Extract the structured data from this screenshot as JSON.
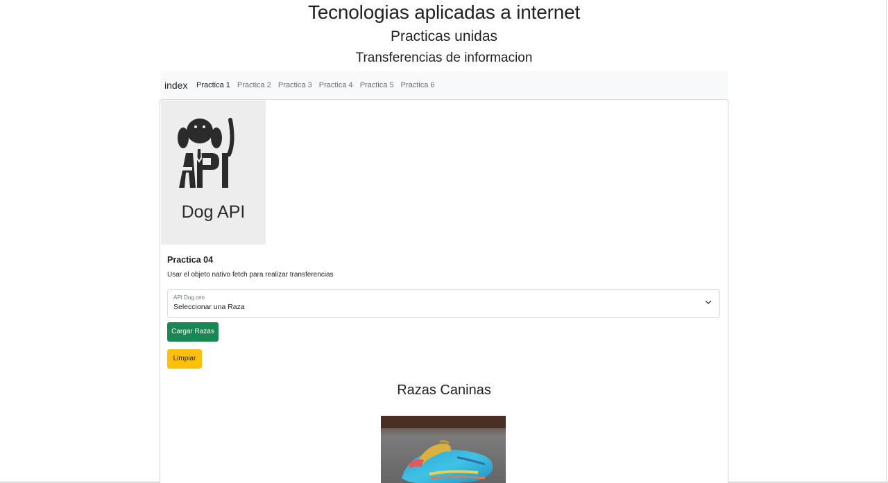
{
  "header": {
    "title": "Tecnologias aplicadas a internet",
    "subtitle": "Practicas unidas",
    "subsubtitle": "Transferencias de informacion"
  },
  "navbar": {
    "brand": "index",
    "items": [
      {
        "label": "Practica 1",
        "active": true
      },
      {
        "label": "Practica 2",
        "active": false
      },
      {
        "label": "Practica 3",
        "active": false
      },
      {
        "label": "Practica 4",
        "active": false
      },
      {
        "label": "Practica 5",
        "active": false
      },
      {
        "label": "Practica 6",
        "active": false
      }
    ]
  },
  "card": {
    "logo_text": "Dog API",
    "title": "Practica 04",
    "text": "Usar el objeto nativo fetch para realizar transferencias",
    "select": {
      "label": "API Dog.ceo",
      "value": "Seleccionar una Raza"
    },
    "buttons": {
      "load": "Cargar Razas",
      "clear": "Limpiar"
    },
    "section_title": "Razas Caninas"
  },
  "colors": {
    "green": "#198754",
    "yellow": "#ffc107",
    "navbar_bg": "#f8f9fa",
    "logo_bg": "#ededed"
  },
  "icons": {
    "logo": "dog-api-logo-icon",
    "select": "chevron-down-icon"
  }
}
